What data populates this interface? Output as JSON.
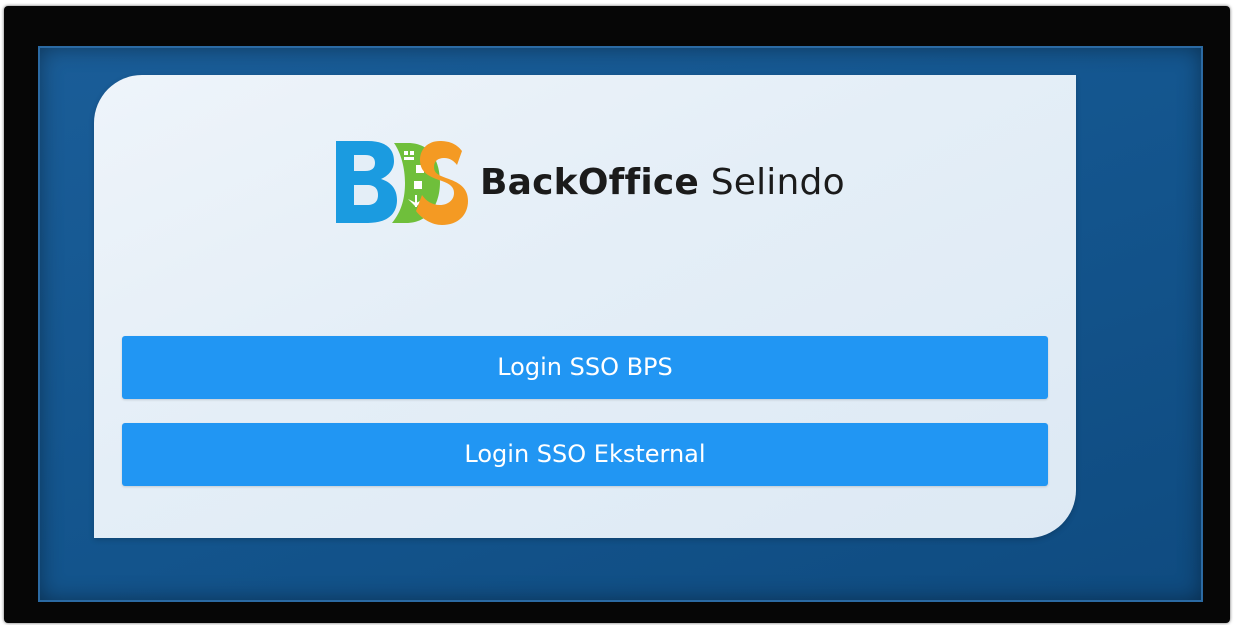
{
  "logo": {
    "mark_letters": "BDS",
    "name_bold": "BackOffice",
    "name_regular": "Selindo",
    "colors": {
      "b": "#1b9be0",
      "d": "#6fbf3b",
      "s": "#f49a23"
    }
  },
  "login": {
    "sso_bps_label": "Login SSO BPS",
    "sso_external_label": "Login SSO Eksternal"
  },
  "theme": {
    "background": "#14568f",
    "card": "#e4eef7",
    "button": "#2196f3"
  }
}
